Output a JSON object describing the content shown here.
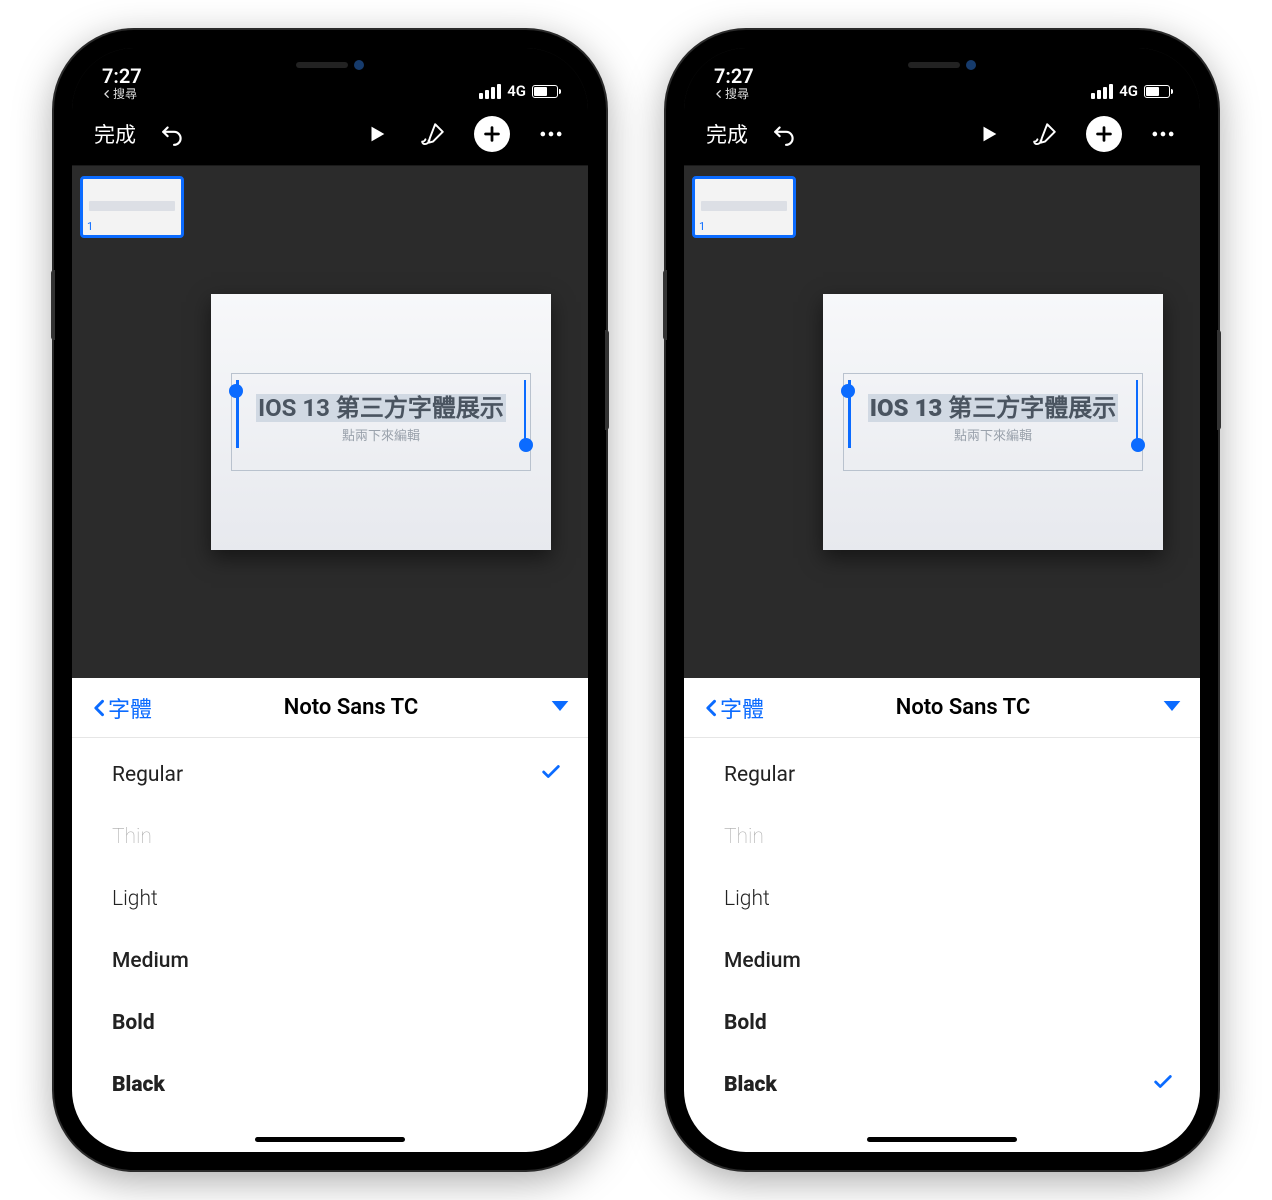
{
  "status": {
    "time": "7:27",
    "back_app": "搜尋",
    "network": "4G"
  },
  "toolbar": {
    "done": "完成"
  },
  "thumb": {
    "number": "1"
  },
  "slide": {
    "title": "IOS 13 第三方字體展示",
    "subtitle": "點兩下來編輯"
  },
  "picker": {
    "back_label": "字體",
    "font_name": "Noto Sans TC",
    "weights": [
      {
        "label": "Regular",
        "class": "w-regular"
      },
      {
        "label": "Thin",
        "class": "w-thin"
      },
      {
        "label": "Light",
        "class": "w-light"
      },
      {
        "label": "Medium",
        "class": "w-medium"
      },
      {
        "label": "Bold",
        "class": "w-bold"
      },
      {
        "label": "Black",
        "class": "w-black"
      }
    ]
  },
  "phones": [
    {
      "selected_weight_index": 0,
      "title_extra_class": ""
    },
    {
      "selected_weight_index": 5,
      "title_extra_class": "black"
    }
  ]
}
